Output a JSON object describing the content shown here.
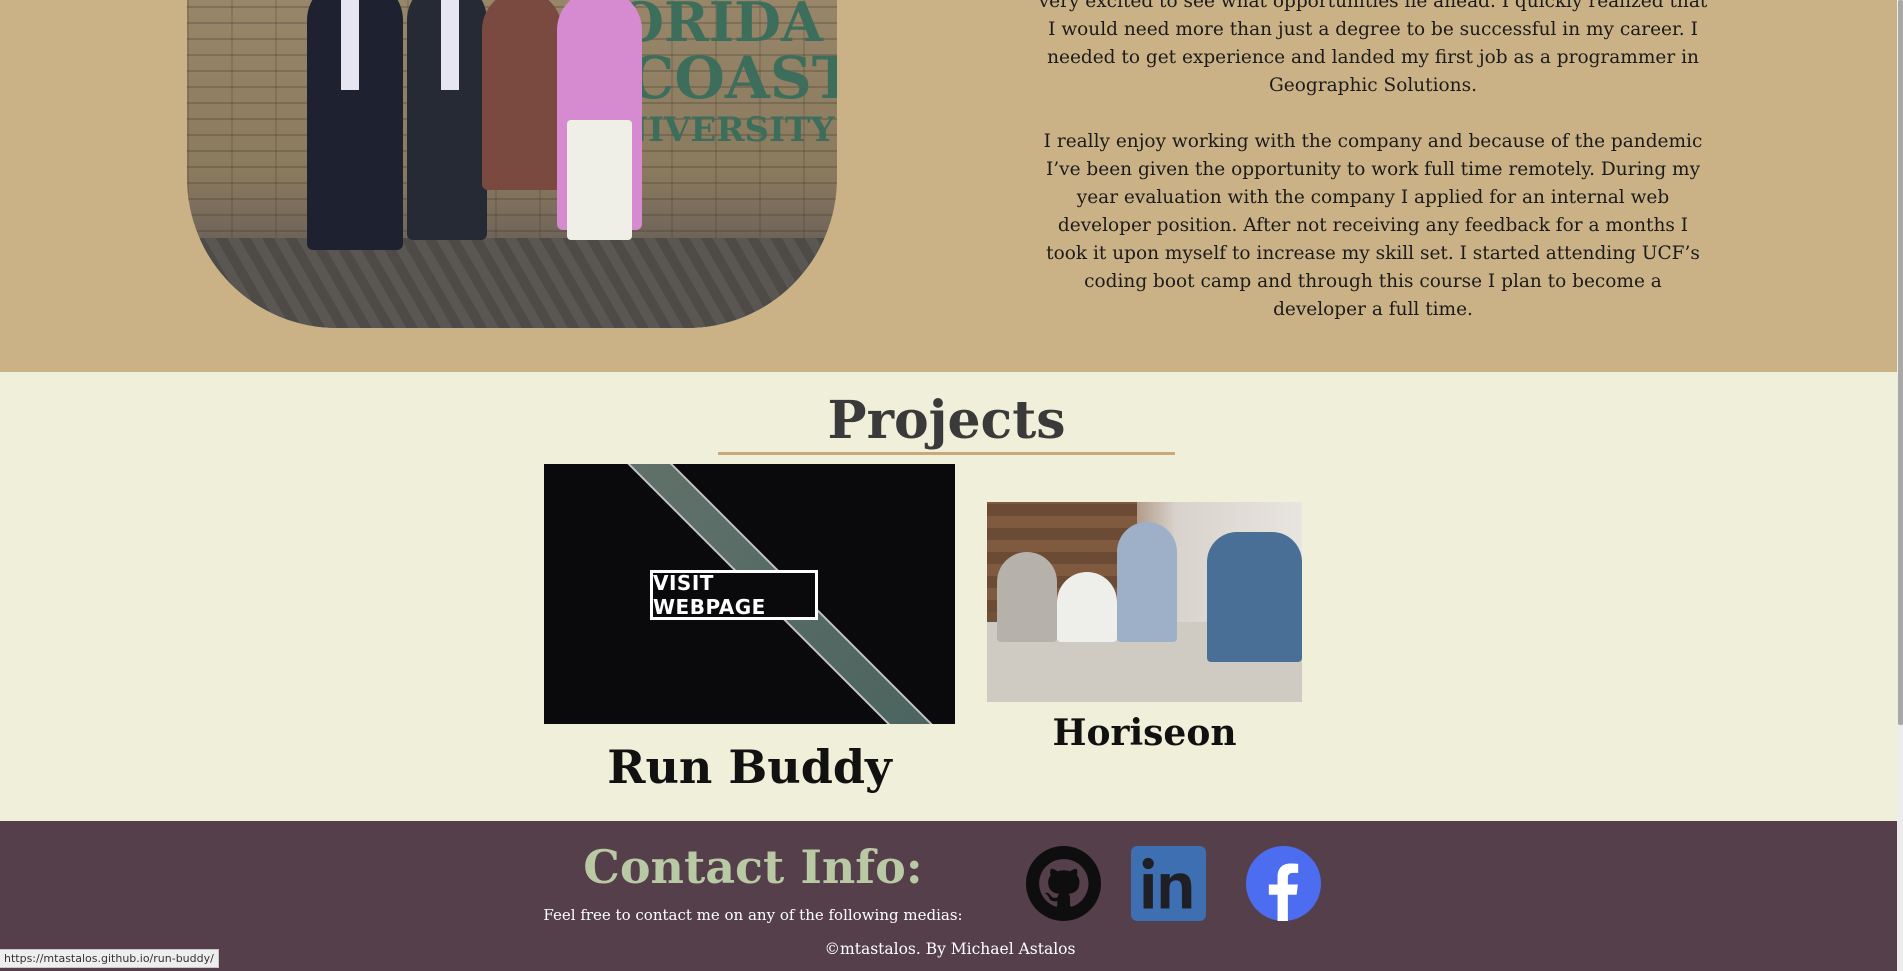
{
  "about": {
    "photo_sign": [
      "ORIDA",
      "FCOAST",
      "NIVERSITY"
    ],
    "paragraphs": [
      "very excited to see what opportunities lie ahead. I quickly realized that I would need more than just a degree to be successful in my career. I needed to get experience and landed my first job as a programmer in Geographic Solutions.",
      "I really enjoy working with the company and because of the pandemic I’ve been given the opportunity to work full time remotely. During my year evaluation with the company I applied for an internal web developer position. After not receiving any feedback for a months I took it upon myself to increase my skill set. I started attending UCF’s coding boot camp and through this course I plan to become a developer a full time."
    ]
  },
  "projects": {
    "title": "Projects",
    "items": [
      {
        "name": "Run Buddy",
        "overlay_label": "VISIT WEBPAGE"
      },
      {
        "name": "Horiseon"
      }
    ]
  },
  "contact": {
    "title": "Contact Info:",
    "subtitle": "Feel free to contact me on any of the following medias:",
    "icons": [
      "github-icon",
      "linkedin-icon",
      "facebook-icon"
    ],
    "copyright": "©mtastalos. By Michael Astalos"
  },
  "status_bar": {
    "url": "https://mtastalos.github.io/run-buddy/"
  },
  "colors": {
    "about_bg": "#cbb286",
    "projects_bg": "#f0efd9",
    "contact_bg": "#553f4a",
    "accent_rule": "#c9a97a",
    "contact_title": "#b9c9a4",
    "facebook_blue": "#4d6df0",
    "linkedin_blue": "#3f6fb3"
  }
}
